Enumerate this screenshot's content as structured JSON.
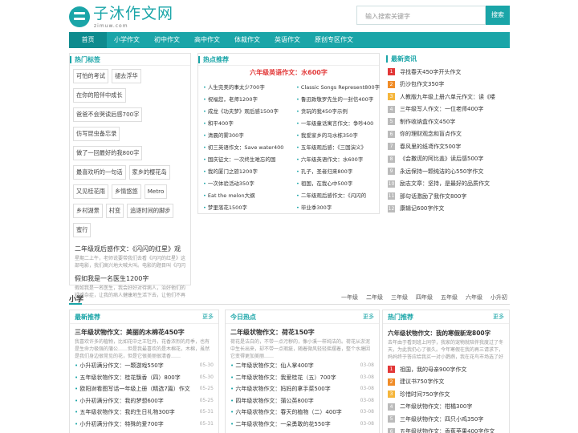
{
  "brand": {
    "name": "子沐作文网",
    "sub": "zimuw.com"
  },
  "search": {
    "placeholder": "输入搜索关键字",
    "button": "搜索"
  },
  "nav": [
    "首页",
    "小学作文",
    "初中作文",
    "高中作文",
    "体裁作文",
    "英语作文",
    "原创专区作文"
  ],
  "tags": {
    "title": "热门标签",
    "items": [
      "可怕的考试",
      "褪去浮华",
      "在你的陪伴中成长",
      "爸爸不会哭读后感700字",
      "仿写昆虫备忘录",
      "做了一回最好的我800字",
      "最喜欢听的一句话",
      "家乡的樱花岛",
      "又见桂花雨",
      "乡情悠悠",
      "Metro",
      "乡村湖景",
      "村变",
      "追逐时间的脚步",
      "蜜行"
    ]
  },
  "left_articles": [
    {
      "title": "二年级观后感作文：《闪闪的红星》观",
      "desc": "星期二上午，老师说要带我们去看《闪闪的红星》这部电影，我们高兴地大喊大叫。电影的题目叫《闪闪"
    },
    {
      "title": "假如我是一名医生1200字",
      "desc": "假如我是一名医生，我会好好对待病人，治好他们的疑难杂症，让我的病人健康地生活下去，让他们不再"
    }
  ],
  "hot": {
    "title": "热点推荐",
    "headline": "六年级英语作文：水600字",
    "items": [
      "人生完美的事太少700字",
      "Classic Songs Represent800字",
      "祝福您，老师1200字",
      "鲁迅致敬罗先生的一封信400字",
      "成龙《功夫梦》观后感1500字",
      "贪玩的我450字示例",
      "和平400字",
      "一年级童话寓言作文：争吵400",
      "清晨的雾300字",
      "我爱家乡的马水栋350字",
      "初三英语作文：Save water400",
      "五年级观后感：《三国演义》",
      "国庆征文：一次终生难忘的国",
      "六年级英语作文：水600字",
      "我的厦门之旅1200字",
      "孔子，圣者归来800字",
      "一次体验活动350字",
      "祖国，在我心中500字",
      "Eat the melon大纲",
      "二年级观后感作文：《闪闪的",
      "梦里落花1500字",
      "毕业季300字"
    ]
  },
  "news": {
    "title": "最新资讯",
    "items": [
      "寻找春天450字开头作文",
      "扔沙包作文350字",
      "人教版九年级上册六单元作文：读《喽",
      "三年级写人作文：一位老师400字",
      "制作收纳盒作文450字",
      "你的理财观念和盲点作文",
      "春风里的纸鸢作文500字",
      "《会撒谎的阿比盖》读后感500字",
      "永远保持一颗纯洁的心550字作文",
      "励志文章：坚持，是最好的品质作文",
      "那句话激励了我作文800字",
      "康辑记600字作文"
    ],
    "nums": [
      "1",
      "2",
      "3",
      "4",
      "5",
      "6",
      "7",
      "8",
      "9",
      "10",
      "11",
      "12"
    ]
  },
  "section": {
    "title": "小学",
    "grades": [
      "一年级",
      "二年级",
      "三年级",
      "四年级",
      "五年级",
      "六年级",
      "小升初"
    ]
  },
  "cols": [
    {
      "title": "最新推荐",
      "more": "更多",
      "lead": {
        "title": "三年级状物作文：美丽的木棉花450字",
        "desc": "我喜欢许多的植物，比如花中之王牡丹，花香浓烈的月季，也有是生命力极强的蒲公……但是我最喜欢的是木棉花，木棉，虽然是我们身边很常见的花，但是它很美丽很清香……"
      },
      "items": [
        {
          "t": "小升初满分作文：一颗游戏550字",
          "d": "05-30"
        },
        {
          "t": "五年级状物作文：桂花飘香（四）800字",
          "d": "05-30"
        },
        {
          "t": "欧阳澍看图写话一年级上册（精选7篇）作文",
          "d": "05-25"
        },
        {
          "t": "小升初满分作文：我的梦想600字",
          "d": "05-25"
        },
        {
          "t": "五年级状物作文：我的生日礼物300字",
          "d": "05-31"
        },
        {
          "t": "小升初满分作文：特殊的爱700字",
          "d": "05-31"
        }
      ]
    },
    {
      "title": "今日热点",
      "more": "更多",
      "lead": {
        "title": "二年级状物作文：荷花150字",
        "desc": "荷花是洁白的，不带一点污秽的，像小溪一样纯洁的。荷花从淤泥中生长出来，却不带一点瑕疵，随着微风轻轻摇摆着，整个水塘因它变得更加美丽……"
      },
      "items": [
        {
          "t": "二年级状物作文：仙人掌400字",
          "d": "03-08"
        },
        {
          "t": "二年级状物作文：我爱桂花（五）700字",
          "d": "03-08"
        },
        {
          "t": "六年级状物作文：妈妈的拿手菜500字",
          "d": "03-08"
        },
        {
          "t": "四年级状物作文：蒲公英800字",
          "d": "03-08"
        },
        {
          "t": "六年级状物作文：春天的植物（二）400字",
          "d": "03-08"
        },
        {
          "t": "二年级状物作文：一朵勇敢的花550字",
          "d": "03-08"
        }
      ]
    },
    {
      "title": "热门推荐",
      "more": "更多",
      "lead": {
        "title": "六年级状物作文：我的寒假新宠800字",
        "desc": "去年由于看到班上同学，我家的宠物就陪伴我度过了冬天，为此我仍心了很久。今年寒假在我的再三请求下，妈妈终于答应给我买一对小鹦鹉，我在花鸟市场选了好久，终于选中了两只……"
      },
      "items": [
        "祖国，我的母亲900字作文",
        "建议书750字作文",
        "珍惜时间750字作文",
        "二年级状物作文：柑橘300字",
        "三年级状物作文：四只小鸡350字",
        "五年级状物作文：香蕉苹果400字作文"
      ],
      "nums": [
        "1",
        "2",
        "3",
        "4",
        "5",
        "6"
      ]
    }
  ]
}
